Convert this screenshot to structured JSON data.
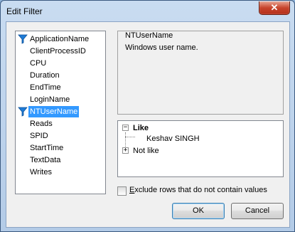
{
  "window": {
    "title": "Edit Filter",
    "close_label": "✕"
  },
  "fields": [
    {
      "label": "ApplicationName",
      "filtered": true,
      "selected": false
    },
    {
      "label": "ClientProcessID",
      "filtered": false,
      "selected": false
    },
    {
      "label": "CPU",
      "filtered": false,
      "selected": false
    },
    {
      "label": "Duration",
      "filtered": false,
      "selected": false
    },
    {
      "label": "EndTime",
      "filtered": false,
      "selected": false
    },
    {
      "label": "LoginName",
      "filtered": false,
      "selected": false
    },
    {
      "label": "NTUserName",
      "filtered": true,
      "selected": true
    },
    {
      "label": "Reads",
      "filtered": false,
      "selected": false
    },
    {
      "label": "SPID",
      "filtered": false,
      "selected": false
    },
    {
      "label": "StartTime",
      "filtered": false,
      "selected": false
    },
    {
      "label": "TextData",
      "filtered": false,
      "selected": false
    },
    {
      "label": "Writes",
      "filtered": false,
      "selected": false
    }
  ],
  "description": {
    "title": "NTUserName",
    "text": "Windows user name."
  },
  "tree": {
    "like": {
      "label": "Like",
      "expander": "−",
      "expanded": true
    },
    "like_value": {
      "label": "Keshav SINGH"
    },
    "not_like": {
      "label": "Not like",
      "expander": "+",
      "expanded": false
    }
  },
  "exclude_checkbox": {
    "label_prefix": "",
    "label_accel": "E",
    "label_rest": "xclude rows that do not contain values",
    "checked": false
  },
  "buttons": {
    "ok": "OK",
    "cancel": "Cancel"
  },
  "colors": {
    "selection": "#3399ff",
    "filter_icon": "#1e7bd6"
  },
  "icons": {
    "filter": "funnel-icon",
    "close": "close-icon"
  }
}
